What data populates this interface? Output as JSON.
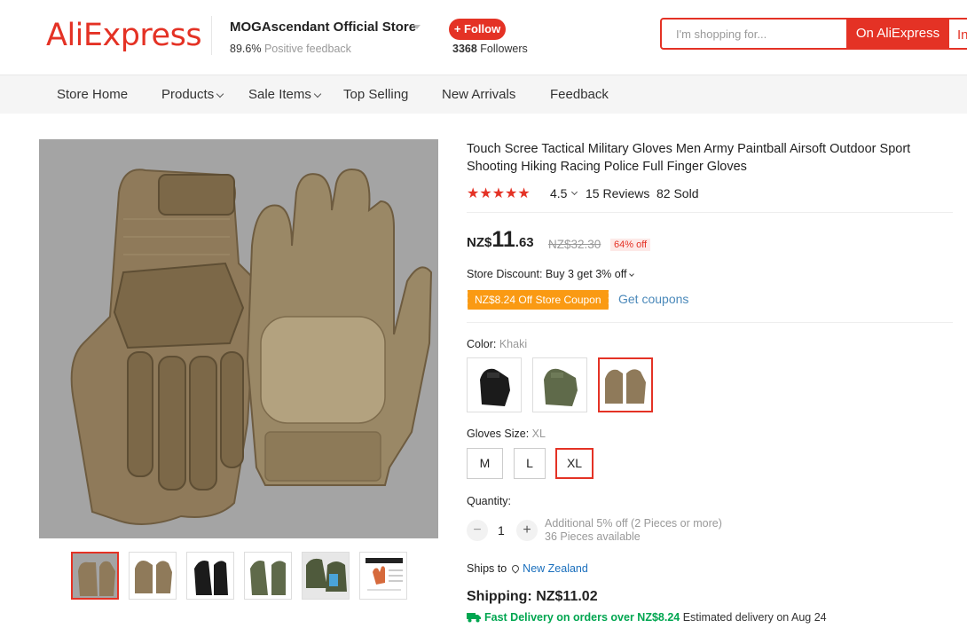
{
  "header": {
    "logo": "AliExpress",
    "store_name": "MOGAscendant Official Store",
    "feedback_pct": "89.6%",
    "feedback_label": "Positive feedback",
    "follow_label": "+ Follow",
    "followers_count": "3368",
    "followers_label": "Followers",
    "search_placeholder": "I'm shopping for...",
    "search_ali_label": "On AliExpress",
    "search_store_label": "In"
  },
  "nav": {
    "items": [
      {
        "label": "Store Home",
        "has_caret": false
      },
      {
        "label": "Products",
        "has_caret": true
      },
      {
        "label": "Sale Items",
        "has_caret": true
      },
      {
        "label": "Top Selling",
        "has_caret": false
      },
      {
        "label": "New Arrivals",
        "has_caret": false
      },
      {
        "label": "Feedback",
        "has_caret": false
      }
    ]
  },
  "product": {
    "title": "Touch Scree Tactical Military Gloves Men Army Paintball Airsoft Outdoor Sport Shooting Hiking Racing Police Full Finger Gloves",
    "stars": 5,
    "rating": "4.5",
    "reviews": "15 Reviews",
    "sold": "82 Sold",
    "price_currency": "NZ$",
    "price_int": "11",
    "price_dec": ".63",
    "original_price": "NZ$32.30",
    "discount": "64% off",
    "store_discount": "Store Discount: Buy 3 get 3% off",
    "coupon": "NZ$8.24 Off Store Coupon",
    "get_coupons": "Get coupons",
    "color_label": "Color:",
    "color_value": "Khaki",
    "colors": [
      {
        "name": "Black",
        "hex": "#1b1b1b",
        "selected": false
      },
      {
        "name": "Green",
        "hex": "#5f6a4a",
        "selected": false
      },
      {
        "name": "Khaki",
        "hex": "#8f7a5a",
        "selected": true
      }
    ],
    "size_label": "Gloves Size:",
    "size_value": "XL",
    "sizes": [
      {
        "label": "M",
        "selected": false
      },
      {
        "label": "L",
        "selected": false
      },
      {
        "label": "XL",
        "selected": true
      }
    ],
    "quantity_label": "Quantity:",
    "quantity": "1",
    "qty_minus": "−",
    "qty_plus": "+",
    "qty_note_1": "Additional 5% off (2 Pieces or more)",
    "qty_note_2": "36 Pieces available",
    "ships_to_label": "Ships to",
    "ships_to_country": "New Zealand",
    "shipping": "Shipping: NZ$11.02",
    "fast_delivery": "Fast Delivery on orders over NZ$8.24",
    "estimated": "Estimated delivery on Aug 24"
  },
  "gallery": {
    "thumbnails": [
      {
        "color": "#8f7a5a",
        "selected": true
      },
      {
        "color": "#8f7a5a",
        "selected": false
      },
      {
        "color": "#1b1b1b",
        "selected": false
      },
      {
        "color": "#5f6a4a",
        "selected": false
      },
      {
        "color": "#5f6a4a",
        "selected": false
      },
      {
        "color": "#d66a3c",
        "selected": false
      }
    ]
  },
  "colors": {
    "brand_red": "#e43225",
    "coupon_orange": "#fa9a13",
    "link_blue": "#4b89ba",
    "fast_green": "#00a650",
    "khaki": "#8f7a5a"
  }
}
